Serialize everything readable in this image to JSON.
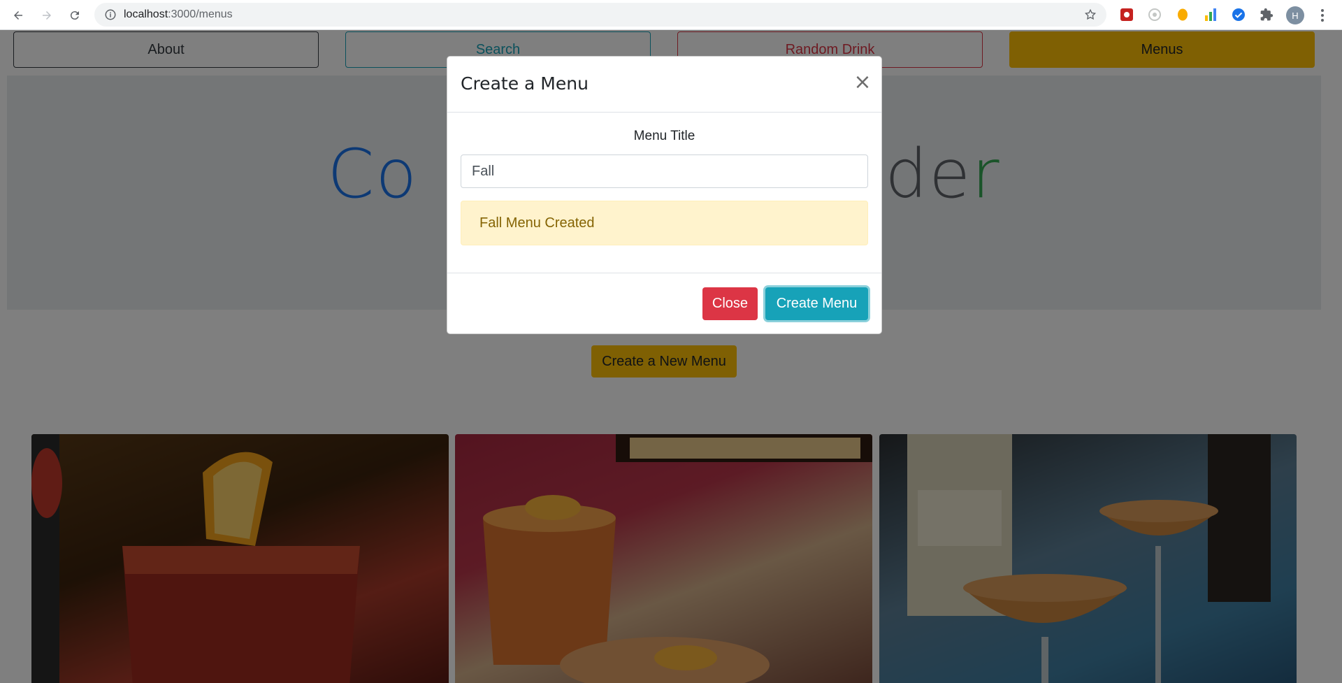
{
  "browser": {
    "url_host": "localhost",
    "url_path": ":3000/menus",
    "profile_initial": "H"
  },
  "nav": {
    "about": "About",
    "search": "Search",
    "random_drink": "Random Drink",
    "menus": "Menus"
  },
  "hero": {
    "visible_left": "Co",
    "visible_right_1": "de",
    "visible_right_2": "r",
    "colors": {
      "left": "#1a73e8",
      "mid": "#5f6368",
      "end": "#34a853"
    }
  },
  "main": {
    "create_new_menu_label": "Create a New Menu"
  },
  "modal": {
    "title": "Create a Menu",
    "close_glyph": "×",
    "field_label": "Menu Title",
    "input_value": "Fall",
    "alert_text": "Fall Menu Created",
    "close_button": "Close",
    "create_button": "Create Menu"
  },
  "colors": {
    "warning": "#ffc107",
    "info": "#17a2b8",
    "danger": "#dc3545",
    "dark": "#343a40"
  }
}
